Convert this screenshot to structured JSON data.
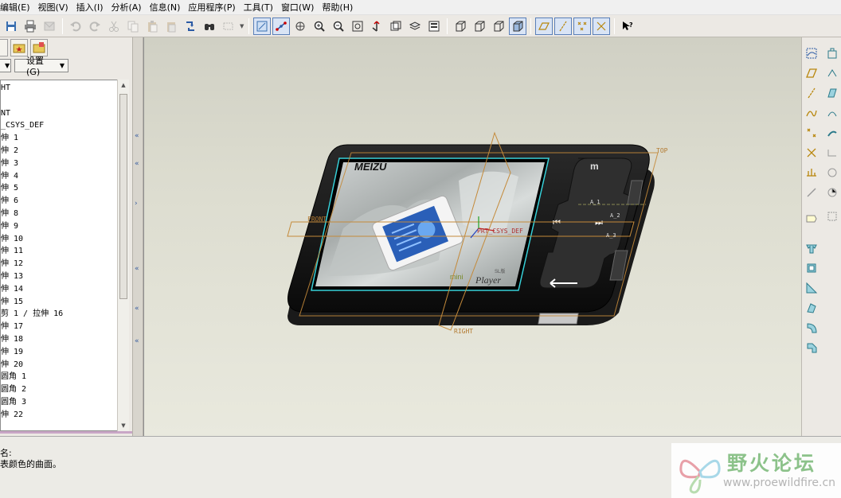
{
  "menu": [
    "编辑(E)",
    "视图(V)",
    "插入(I)",
    "分析(A)",
    "信息(N)",
    "应用程序(P)",
    "工具(T)",
    "窗口(W)",
    "帮助(H)"
  ],
  "left_panel": {
    "settings_dropdown": "设置(G)",
    "tree_items": [
      "HT",
      "",
      "NT",
      "_CSYS_DEF",
      "伸 1",
      "伸 2",
      "伸 3",
      "伸 4",
      "伸 5",
      "伸 6",
      "伸 8",
      "伸 9",
      "伸 10",
      "伸 11",
      "伸 12",
      "伸 13",
      "伸 14",
      "伸 15",
      "剪 1 / 拉伸 16",
      "伸 17",
      "伸 18",
      "伸 19",
      "伸 20",
      "圆角 1",
      "圆角 2",
      "圆角 3",
      "伸 22"
    ]
  },
  "viewport": {
    "datum_labels": {
      "top": "TOP",
      "front": "FRONT",
      "right": "RIGHT",
      "csys": "PRT_CSYS_DEF",
      "a1": "A_1",
      "a2": "A_2",
      "a3": "A_3"
    },
    "device": {
      "brand": "MEIZU",
      "logo_mark": "m",
      "screen_tagline": "Player",
      "screen_sub": "mini",
      "screen_model": "SL版"
    }
  },
  "messages": [
    "名:",
    "表颜色的曲面。"
  ],
  "watermark": {
    "title": "野火论坛",
    "url": "www.proewildfire.cn"
  },
  "colors": {
    "accent": "#5a7fb8",
    "datum": "#c48a3a",
    "body": "#151515",
    "screen_frame": "#37d0d8"
  }
}
